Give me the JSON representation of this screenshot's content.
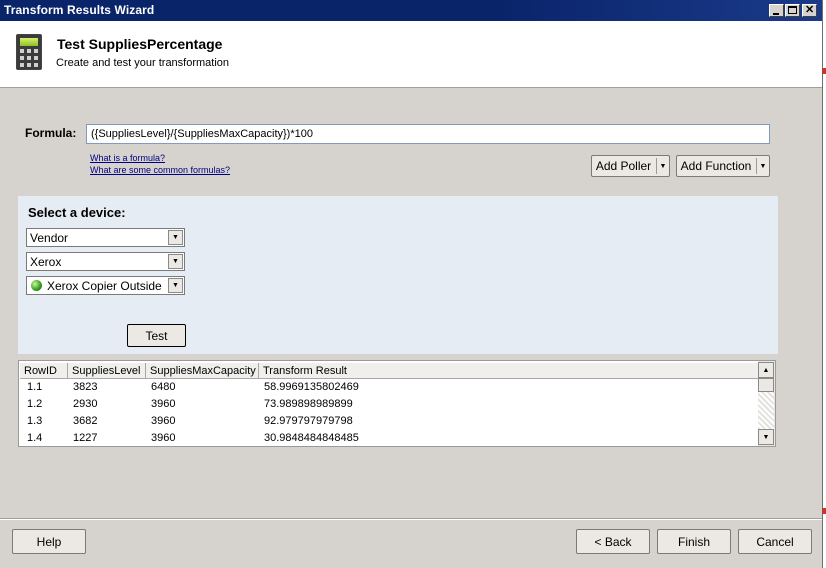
{
  "window": {
    "title": "Transform Results Wizard"
  },
  "header": {
    "title": "Test SuppliesPercentage",
    "subtitle": "Create and test your transformation",
    "icon": "calculator-icon"
  },
  "formula": {
    "label": "Formula:",
    "value": "({SuppliesLevel}/{SuppliesMaxCapacity})*100",
    "links": [
      "What is a formula?",
      "What are some common formulas?"
    ],
    "add_poller_label": "Add Poller",
    "add_function_label": "Add Function"
  },
  "device": {
    "title": "Select a device:",
    "combos": [
      "Vendor",
      "Xerox",
      "Xerox Copier Outside"
    ],
    "status_color": "#2f9a1a",
    "test_label": "Test"
  },
  "grid": {
    "columns": [
      "RowID",
      "SuppliesLevel",
      "SuppliesMaxCapacity",
      "Transform Result"
    ],
    "rows": [
      [
        "1.1",
        "3823",
        "6480",
        "58.9969135802469"
      ],
      [
        "1.2",
        "2930",
        "3960",
        "73.989898989899"
      ],
      [
        "1.3",
        "3682",
        "3960",
        "92.979797979798"
      ],
      [
        "1.4",
        "1227",
        "3960",
        "30.9848484848485"
      ]
    ]
  },
  "footer": {
    "help_label": "Help",
    "back_label": "< Back",
    "finish_label": "Finish",
    "cancel_label": "Cancel"
  },
  "colors": {
    "titlebar": "#0a246a",
    "dialog_bg": "#d6d3ce",
    "device_panel": "#e6ecf3",
    "link": "#000080"
  }
}
